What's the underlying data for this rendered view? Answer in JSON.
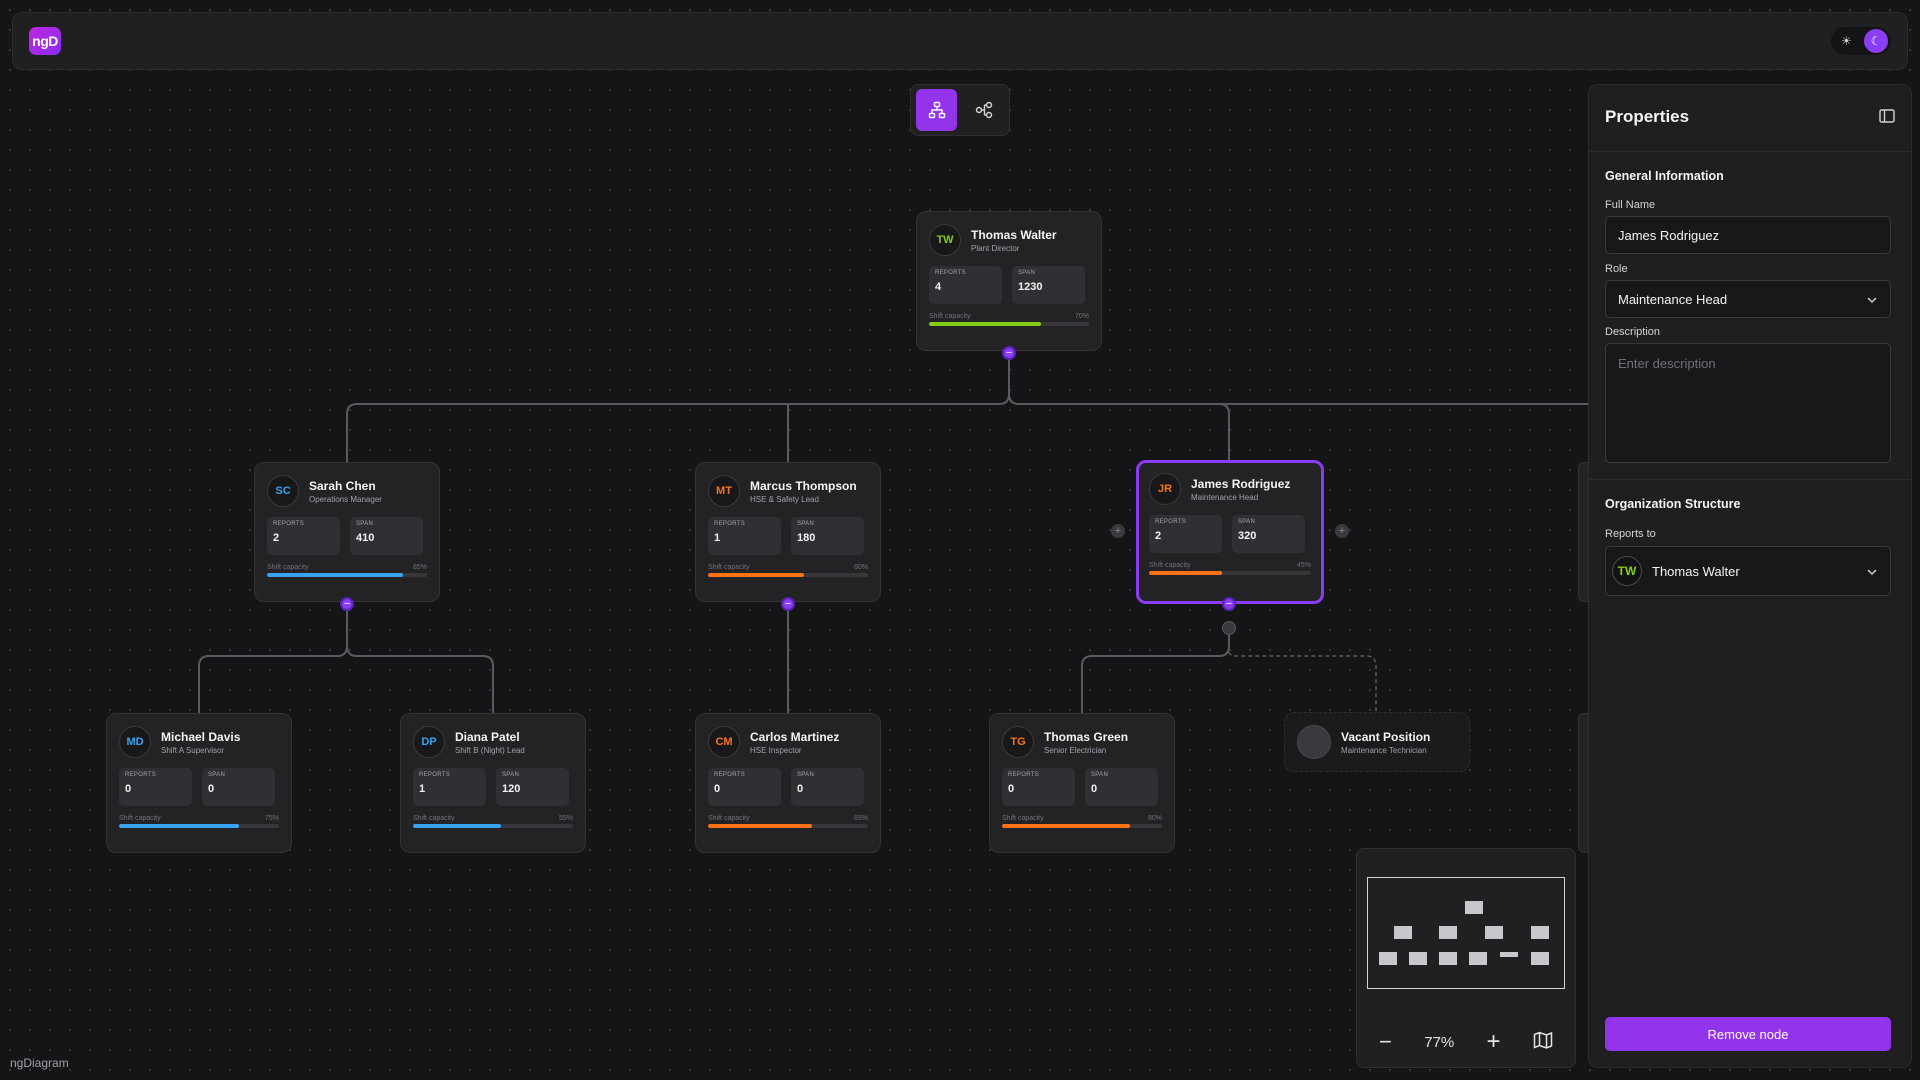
{
  "app": {
    "logo": "ngD",
    "brand": "ngDiagram"
  },
  "toolbar": {
    "sun_icon": "sun-icon",
    "moon_icon": "moon-icon",
    "layout_tree_icon": "org-tree-icon",
    "layout_graph_icon": "graph-icon"
  },
  "labels": {
    "reports": "REPORTS",
    "span": "SPAN",
    "capacity": "Shift capacity"
  },
  "nodes": {
    "thomas_walter": {
      "initials": "TW",
      "name": "Thomas Walter",
      "role": "Plant Director",
      "reports": "4",
      "span": "1230",
      "capacity": "70%",
      "capacity_value": 0.7,
      "color": "#84cc16"
    },
    "sarah_chen": {
      "initials": "SC",
      "name": "Sarah Chen",
      "role": "Operations Manager",
      "reports": "2",
      "span": "410",
      "capacity": "85%",
      "capacity_value": 0.85,
      "color": "#38a3f0"
    },
    "marcus_thompson": {
      "initials": "MT",
      "name": "Marcus Thompson",
      "role": "HSE & Safety Lead",
      "reports": "1",
      "span": "180",
      "capacity": "60%",
      "capacity_value": 0.6,
      "color": "#f97316"
    },
    "james_rodriguez": {
      "initials": "JR",
      "name": "James Rodriguez",
      "role": "Maintenance Head",
      "reports": "2",
      "span": "320",
      "capacity": "45%",
      "capacity_value": 0.45,
      "color": "#f97316"
    },
    "michael_davis": {
      "initials": "MD",
      "name": "Michael Davis",
      "role": "Shift A Supervisor",
      "reports": "0",
      "span": "0",
      "capacity": "75%",
      "capacity_value": 0.75,
      "color": "#38a3f0"
    },
    "diana_patel": {
      "initials": "DP",
      "name": "Diana Patel",
      "role": "Shift B (Night) Lead",
      "reports": "1",
      "span": "120",
      "capacity": "55%",
      "capacity_value": 0.55,
      "color": "#38a3f0"
    },
    "carlos_martinez": {
      "initials": "CM",
      "name": "Carlos Martinez",
      "role": "HSE Inspector",
      "reports": "0",
      "span": "0",
      "capacity": "65%",
      "capacity_value": 0.65,
      "color": "#f97316"
    },
    "thomas_green": {
      "initials": "TG",
      "name": "Thomas Green",
      "role": "Senior Electrician",
      "reports": "0",
      "span": "0",
      "capacity": "80%",
      "capacity_value": 0.8,
      "color": "#f97316"
    }
  },
  "vacant": {
    "name": "Vacant Position",
    "role": "Maintenance Technician"
  },
  "minimap": {
    "zoom": "77%"
  },
  "properties": {
    "title": "Properties",
    "general_section": "General Information",
    "full_name_label": "Full Name",
    "full_name_value": "James Rodriguez",
    "role_label": "Role",
    "role_value": "Maintenance Head",
    "description_label": "Description",
    "description_placeholder": "Enter description",
    "org_section": "Organization Structure",
    "reports_to_label": "Reports to",
    "reports_to_initials": "TW",
    "reports_to_value": "Thomas Walter",
    "remove_button": "Remove node"
  },
  "colors": {
    "accent": "#9333ea",
    "green": "#84cc16",
    "blue": "#38a3f0",
    "orange": "#f97316"
  }
}
